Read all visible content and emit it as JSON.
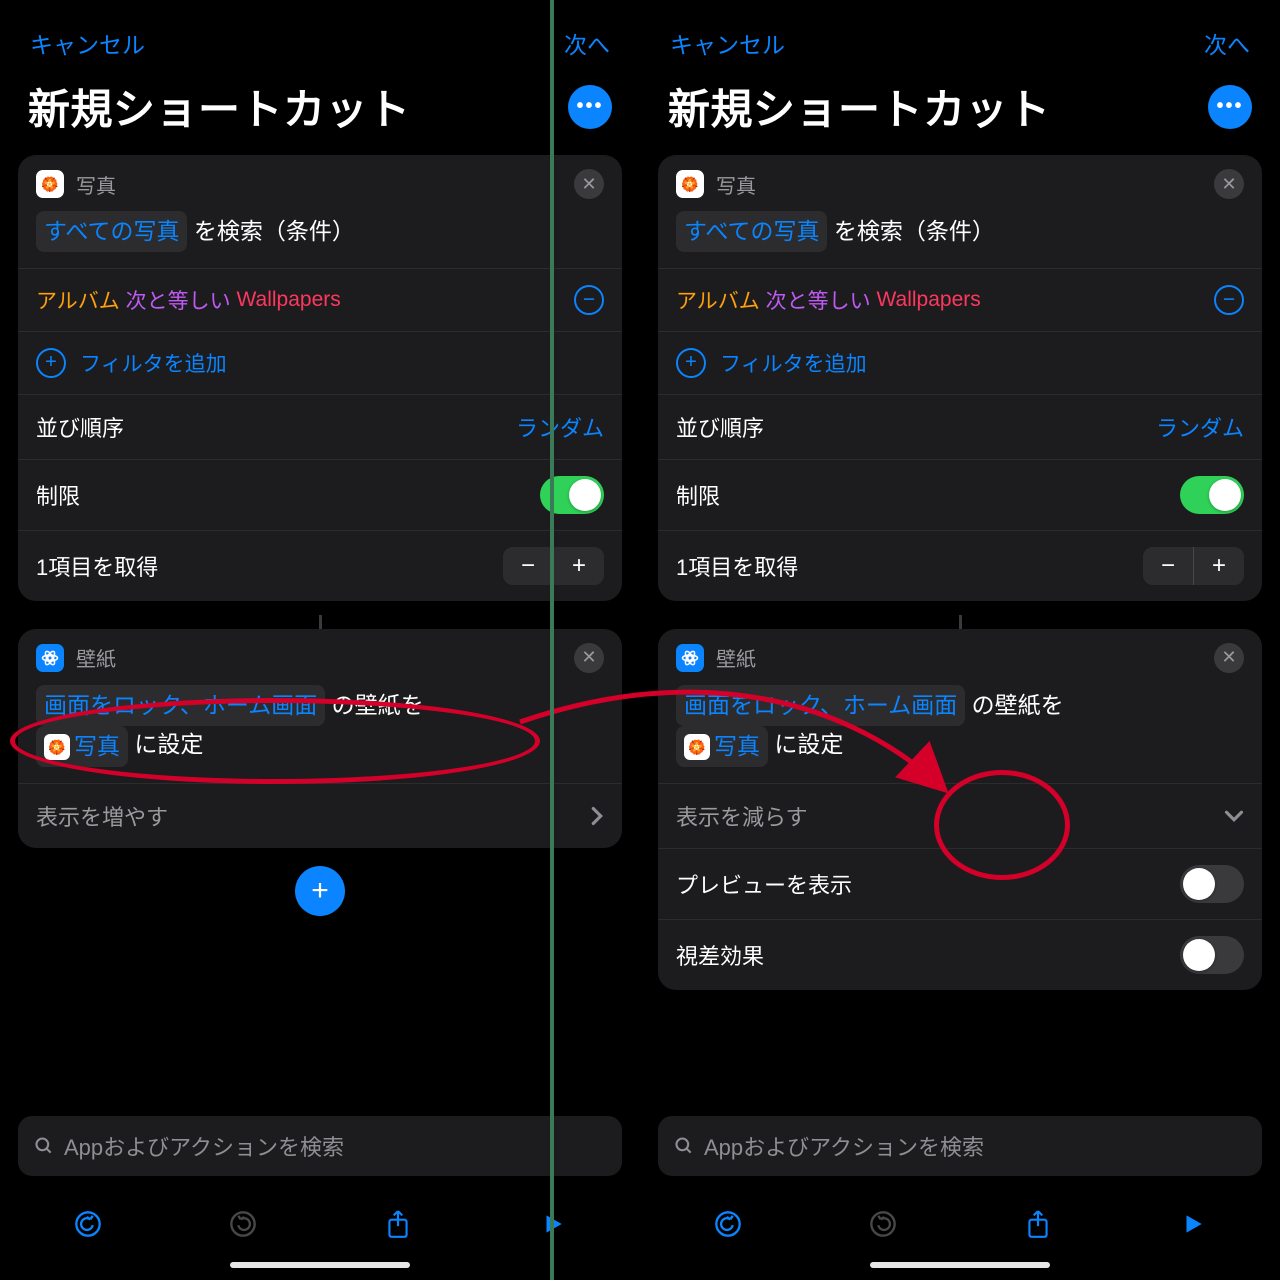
{
  "nav": {
    "cancel": "キャンセル",
    "next": "次へ"
  },
  "title": "新規ショートカット",
  "photos": {
    "name": "写真",
    "token_all_photos": "すべての写真",
    "search_text": " を検索（条件）",
    "filter_album": "アルバム",
    "filter_eq": "次と等しい",
    "filter_val": "Wallpapers",
    "add_filter": "フィルタを追加",
    "sort_label": "並び順序",
    "sort_value": "ランダム",
    "limit_label": "制限",
    "get_label": "1項目を取得"
  },
  "wallpaper": {
    "name": "壁紙",
    "token_lock_home": "画面をロック、ホーム画面",
    "tail1": " の壁紙を",
    "token_photos_var": "写真",
    "tail2": " に設定",
    "show_more": "表示を増やす",
    "show_less": "表示を減らす",
    "preview_label": "プレビューを表示",
    "parallax_label": "視差効果"
  },
  "search": {
    "placeholder": "Appおよびアクションを検索"
  }
}
